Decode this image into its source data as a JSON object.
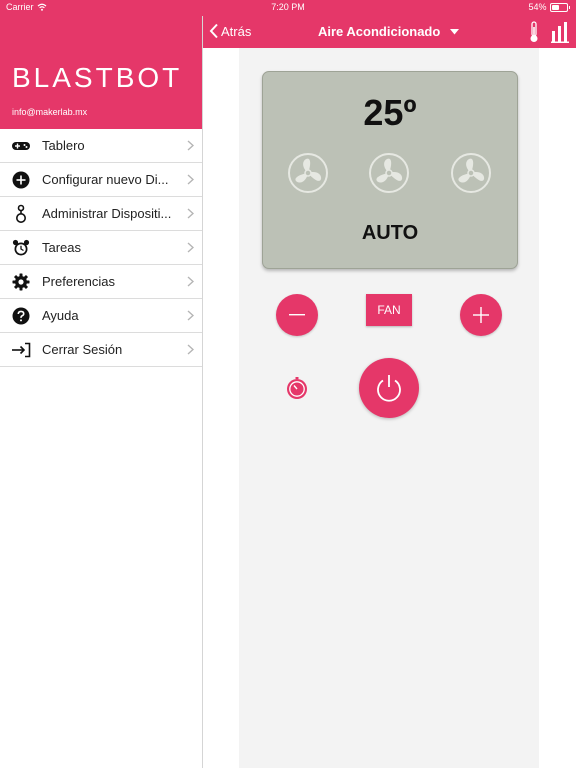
{
  "status_bar": {
    "carrier": "Carrier",
    "time": "7:20 PM",
    "battery_text": "54%",
    "battery_level": 0.54
  },
  "sidebar": {
    "logo": "BLASTBOT",
    "email": "info@makerlab.mx",
    "items": [
      {
        "label": "Tablero",
        "icon": "gamepad-icon"
      },
      {
        "label": "Configurar nuevo Di...",
        "icon": "add-circle-icon"
      },
      {
        "label": "Administrar Dispositi...",
        "icon": "device-link-icon"
      },
      {
        "label": "Tareas",
        "icon": "alarm-clock-icon"
      },
      {
        "label": "Preferencias",
        "icon": "gear-icon"
      },
      {
        "label": "Ayuda",
        "icon": "help-icon"
      },
      {
        "label": "Cerrar Sesión",
        "icon": "logout-icon"
      }
    ]
  },
  "navbar": {
    "back_label": "Atrás",
    "title": "Aire Acondicionado"
  },
  "display": {
    "temperature": "25º",
    "mode": "AUTO",
    "fan_icons": [
      "fan-icon",
      "fan-icon",
      "fan-icon"
    ]
  },
  "controls": {
    "fan_label": "FAN"
  },
  "colors": {
    "accent": "#e53769",
    "display_bg": "#bcc1b6",
    "content_bg": "#f3f3f3"
  }
}
